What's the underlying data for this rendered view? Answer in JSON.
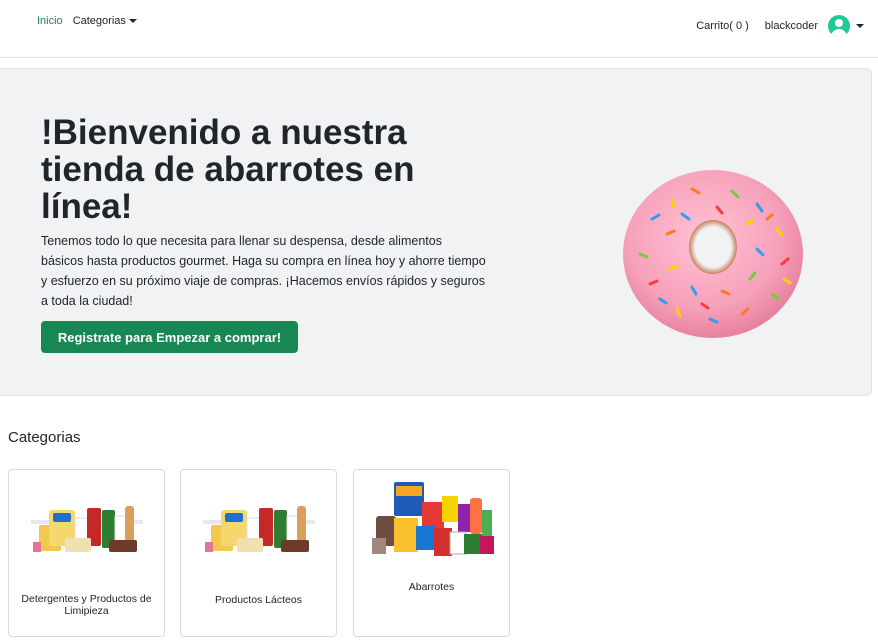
{
  "nav": {
    "home": "Inicio",
    "categories": "Categorias",
    "cart": "Carrito( 0 )",
    "username": "blackcoder"
  },
  "hero": {
    "title": "!Bienvenido a nuestra tienda de abarrotes en línea!",
    "text": "Tenemos todo lo que necesita para llenar su despensa, desde alimentos básicos hasta productos gourmet. Haga su compra en línea hoy y ahorre tiempo y esfuerzo en su próximo viaje de compras. ¡Hacemos envíos rápidos y seguros a toda la ciudad!",
    "button": "Registrate para Empezar a comprar!"
  },
  "categories": {
    "title": "Categorias",
    "items": [
      {
        "label": "Detergentes y Productos de Limipieza"
      },
      {
        "label": "Productos Lácteos"
      },
      {
        "label": "Abarrotes"
      }
    ]
  },
  "colors": {
    "primary": "#198754",
    "avatar": "#20c997",
    "hero_bg": "#f0f2f4"
  }
}
